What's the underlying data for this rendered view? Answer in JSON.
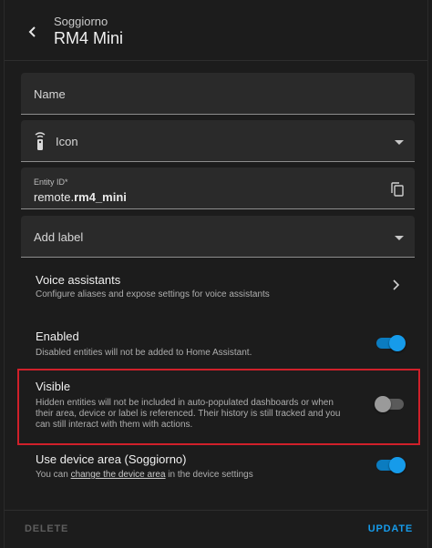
{
  "header": {
    "subtitle": "Soggiorno",
    "title": "RM4 Mini"
  },
  "fields": {
    "name_label": "Name",
    "icon_label": "Icon",
    "entity_id_label": "Entity ID*",
    "entity_id_prefix": "remote.",
    "entity_id_object": "rm4_mini",
    "add_label": "Add label"
  },
  "voice_assistants": {
    "title": "Voice assistants",
    "description": "Configure aliases and expose settings for voice assistants"
  },
  "enabled": {
    "title": "Enabled",
    "description": "Disabled entities will not be added to Home Assistant.",
    "state": true
  },
  "visible": {
    "title": "Visible",
    "description_line1": "Hidden entities will not be included in auto-populated dashboards or when",
    "description_line2": "their area, device or label is referenced. Their history is still tracked and you",
    "description_line3": "can still interact with them with actions.",
    "state": false
  },
  "use_device_area": {
    "title": "Use device area (Soggiorno)",
    "description_prefix": "You can ",
    "description_link": "change the device area",
    "description_suffix": " in the device settings",
    "state": true
  },
  "footer": {
    "delete_label": "DELETE",
    "update_label": "UPDATE"
  },
  "colors": {
    "accent": "#169bea",
    "highlight": "#d0202a",
    "background": "#1c1c1c"
  },
  "icons": [
    "back-arrow-icon",
    "remote-icon",
    "chevron-down-icon",
    "copy-icon",
    "chevron-right-icon"
  ]
}
